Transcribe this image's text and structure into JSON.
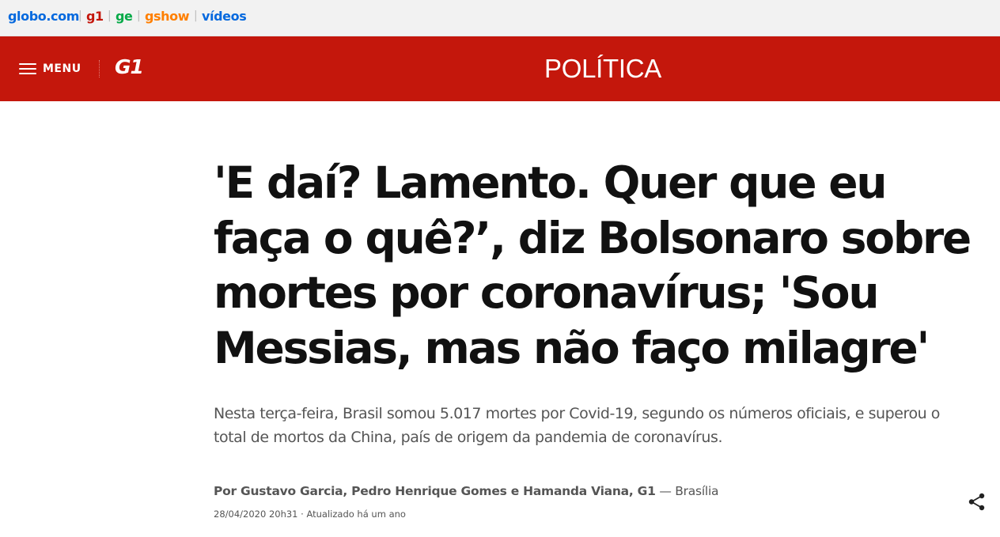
{
  "topbar": {
    "links": [
      {
        "label": "globo.com",
        "color": "#0669de"
      },
      {
        "label": "g1",
        "color": "#c4170c"
      },
      {
        "label": "ge",
        "color": "#06aa48"
      },
      {
        "label": "gshow",
        "color": "#ff7f00"
      },
      {
        "label": "vídeos",
        "color": "#0669de"
      }
    ],
    "separator": "|"
  },
  "header": {
    "background": "#c4170c",
    "menu_label": "MENU",
    "logo_text": "G1",
    "section_title": "POLÍTICA"
  },
  "article": {
    "headline": "'E daí? Lamento. Quer que eu faça o quê?’, diz Bolsonaro sobre mortes por coronavírus; 'Sou Messias, mas não faço milagre'",
    "subtitle": "Nesta terça-feira, Brasil somou 5.017 mortes por Covid-19, segundo os números oficiais, e superou o total de mortos da China, país de origem da pandemia de coronavírus.",
    "byline_authors": "Por Gustavo Garcia, Pedro Henrique Gomes e Hamanda Viana, G1",
    "byline_location": " — Brasília",
    "meta": "28/04/2020 20h31 · Atualizado há um ano"
  },
  "icons": {
    "menu": "hamburger-icon",
    "share": "share-icon"
  }
}
